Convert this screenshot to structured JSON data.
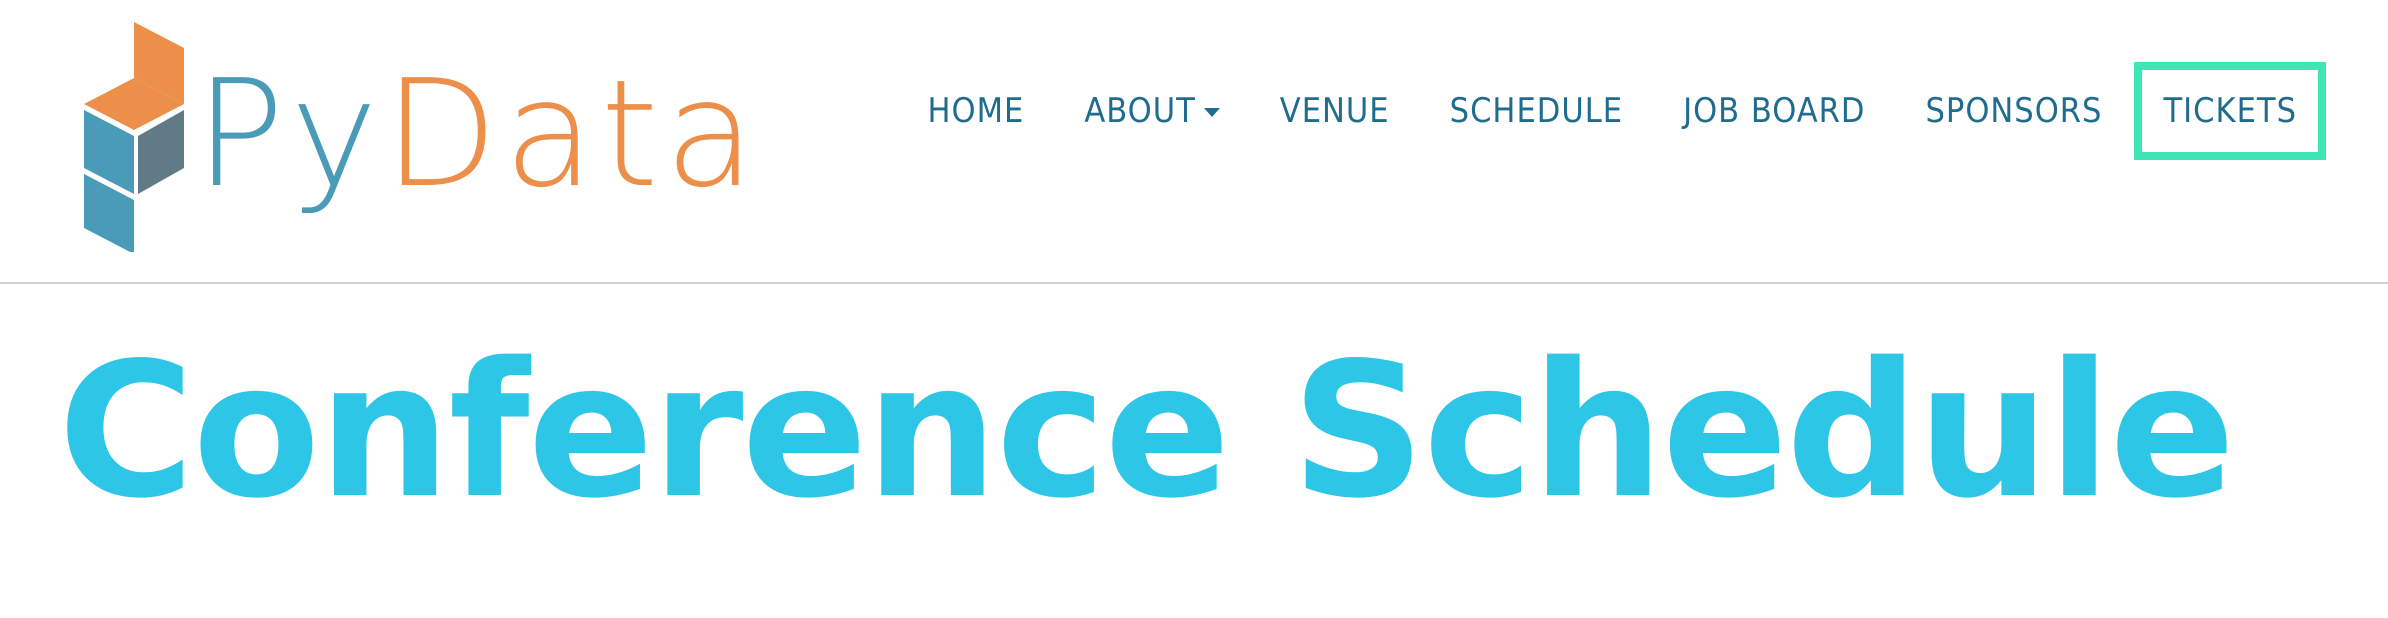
{
  "logo": {
    "text_py": "Py",
    "text_data": "Data",
    "colors": {
      "blue": "#4a9bb8",
      "orange": "#ec8f4a",
      "slate": "#607b85"
    }
  },
  "nav": {
    "items": [
      {
        "label": "HOME"
      },
      {
        "label": "ABOUT",
        "has_dropdown": true
      },
      {
        "label": "VENUE"
      },
      {
        "label": "SCHEDULE"
      },
      {
        "label": "JOB BOARD"
      },
      {
        "label": "SPONSORS"
      },
      {
        "label": "TICKETS",
        "highlighted": true
      }
    ],
    "color": "#1f6c8e",
    "highlight_color": "#3ee6b5"
  },
  "main": {
    "title": "Conference Schedule",
    "title_color": "#2dc6e6"
  }
}
